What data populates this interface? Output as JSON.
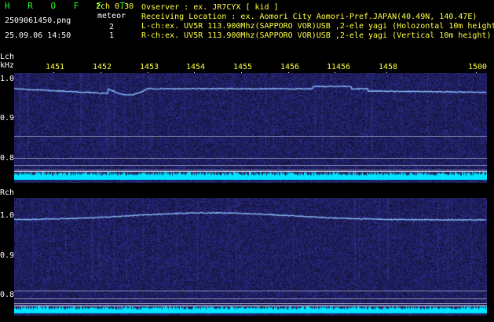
{
  "header": {
    "app_title": "H R O F F T",
    "mode": "2ch 0.30",
    "event_label": "meteor",
    "count_lch": "2",
    "count_rch": "1",
    "filename": "2509061450.png",
    "datetime": "25.09.06 14:50",
    "observer": "Ovserver              : ex. JR7CYX [ kid ]",
    "location": "Receiving Location : ex. Aomori City Aomori-Pref.JAPAN(40.49N, 140.47E)",
    "lch_info": "L-ch:ex. UV5R 113.900Mhz(SAPPORO VOR)USB ,2-ele yagi (Holozontal 10m height)",
    "rch_info": "R-ch:ex. UV5R 113.900Mhz(SAPPORO VOR)USB ,2-ele yagi (Vertical 10m height)"
  },
  "channels": {
    "lch_label": "Lch",
    "unit_label": "kHz",
    "rch_label": "Rch"
  },
  "time_ticks": [
    "1451",
    "1452",
    "1453",
    "1454",
    "1455",
    "1456",
    "11456",
    "1458",
    "1500"
  ],
  "y_ticks": [
    "1.0",
    "0.9",
    "0.8"
  ],
  "colors": {
    "background": "#000000",
    "noise": "#1a1a6e",
    "trace": "#7fb4ff",
    "meter": "#00ffff",
    "label_green": "#22ff22",
    "label_yellow": "#ffff44"
  }
}
